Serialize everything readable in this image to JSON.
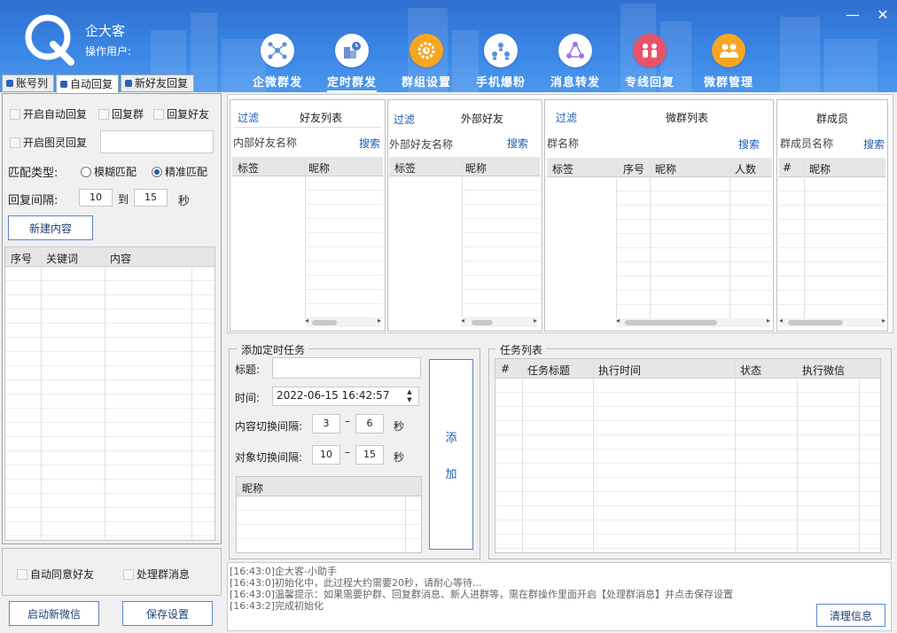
{
  "app": {
    "title": "企大客",
    "operator_label": "操作用户:"
  },
  "window": {
    "minimize": "—",
    "close": "✕"
  },
  "nav": [
    {
      "label": "企微群发",
      "icon": "network-icon"
    },
    {
      "label": "定时群发",
      "icon": "schedule-icon",
      "active": true
    },
    {
      "label": "群组设置",
      "icon": "group-settings-icon"
    },
    {
      "label": "手机爆粉",
      "icon": "phone-fans-icon"
    },
    {
      "label": "消息转发",
      "icon": "message-forward-icon"
    },
    {
      "label": "专线回复",
      "icon": "dedicated-reply-icon"
    },
    {
      "label": "微群管理",
      "icon": "group-manage-icon"
    }
  ],
  "left": {
    "tabs": [
      "账号列",
      "自动回复",
      "新好友回复"
    ],
    "auto_reply": "开启自动回复",
    "reply_group": "回复群",
    "reply_friend": "回复好友",
    "image_reply": "开启图灵回复",
    "match_type_label": "匹配类型:",
    "fuzzy": "模糊匹配",
    "exact": "精准匹配",
    "interval_label": "回复间隔:",
    "interval_from": "10",
    "to_label": "到",
    "interval_to": "15",
    "seconds": "秒",
    "new_content": "新建内容",
    "table_headers": [
      "序号",
      "关键词",
      "内容"
    ],
    "auto_accept": "自动同意好友",
    "handle_group_msg": "处理群消息",
    "start_wechat": "启动新微信",
    "save_settings": "保存设置"
  },
  "panels": {
    "friends": {
      "filter": "过滤",
      "title": "好友列表",
      "search_label": "内部好友名称",
      "search": "搜索",
      "cols": [
        "标签",
        "昵称"
      ]
    },
    "external": {
      "filter": "过滤",
      "title": "外部好友",
      "search_label": "外部好友名称",
      "search": "搜索",
      "cols": [
        "标签",
        "昵称"
      ]
    },
    "groups": {
      "filter": "过滤",
      "title": "微群列表",
      "search_label": "群名称",
      "search": "搜索",
      "cols": [
        "标签",
        "序号",
        "昵称",
        "人数"
      ]
    },
    "members": {
      "title": "群成员",
      "search_label": "群成员名称",
      "search": "搜索",
      "cols": [
        "#",
        "昵称"
      ]
    }
  },
  "task_form": {
    "group_title": "添加定时任务",
    "title_label": "标题:",
    "title_value": "",
    "time_label": "时间:",
    "time_value": "2022-06-15 16:42:57",
    "content_interval_label": "内容切换间隔:",
    "content_from": "3",
    "content_to": "6",
    "target_interval_label": "对象切换间隔:",
    "target_from": "10",
    "target_to": "15",
    "dash": "–",
    "seconds": "秒",
    "nick_header": "昵称",
    "add_char1": "添",
    "add_char2": "加"
  },
  "task_list": {
    "group_title": "任务列表",
    "cols": [
      "#",
      "任务标题",
      "执行时间",
      "状态",
      "执行微信"
    ]
  },
  "log": {
    "lines": [
      "[16:43:0]企大客-小助手",
      "[16:43:0]初始化中，此过程大约需要20秒，请耐心等待...",
      "[16:43:0]温馨提示：如果需要护群、回复群消息、新人进群等，需在群操作里面开启【处理群消息】并点击保存设置",
      "[16:43:2]完成初始化"
    ],
    "clear": "清理信息"
  },
  "colors": {
    "header_top": "#2f6fcf",
    "header_bottom": "#4b97ee",
    "link": "#1a5fb4",
    "accent": "#2b63b8"
  }
}
